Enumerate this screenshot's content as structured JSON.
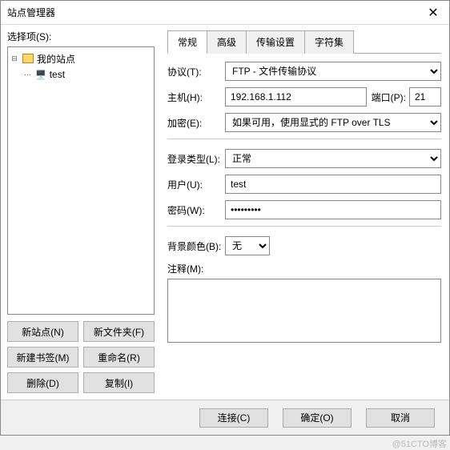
{
  "window": {
    "title": "站点管理器"
  },
  "left": {
    "select_label": "选择项(S):",
    "tree": {
      "root": "我的站点",
      "item": "test"
    },
    "buttons": {
      "new_site": "新站点(N)",
      "new_folder": "新文件夹(F)",
      "new_bookmark": "新建书签(M)",
      "rename": "重命名(R)",
      "delete": "删除(D)",
      "copy": "复制(I)"
    }
  },
  "tabs": {
    "general": "常规",
    "advanced": "高级",
    "transfer": "传输设置",
    "charset": "字符集"
  },
  "form": {
    "protocol_label": "协议(T):",
    "protocol_value": "FTP - 文件传输协议",
    "host_label": "主机(H):",
    "host_value": "192.168.1.112",
    "port_label": "端口(P):",
    "port_value": "21",
    "encryption_label": "加密(E):",
    "encryption_value": "如果可用，使用显式的 FTP over TLS",
    "logon_label": "登录类型(L):",
    "logon_value": "正常",
    "user_label": "用户(U):",
    "user_value": "test",
    "password_label": "密码(W):",
    "password_value": "password1",
    "bgcolor_label": "背景颜色(B):",
    "bgcolor_value": "无",
    "comments_label": "注释(M):",
    "comments_value": ""
  },
  "bottom": {
    "connect": "连接(C)",
    "ok": "确定(O)",
    "cancel": "取消"
  },
  "watermark": "@51CTO博客"
}
